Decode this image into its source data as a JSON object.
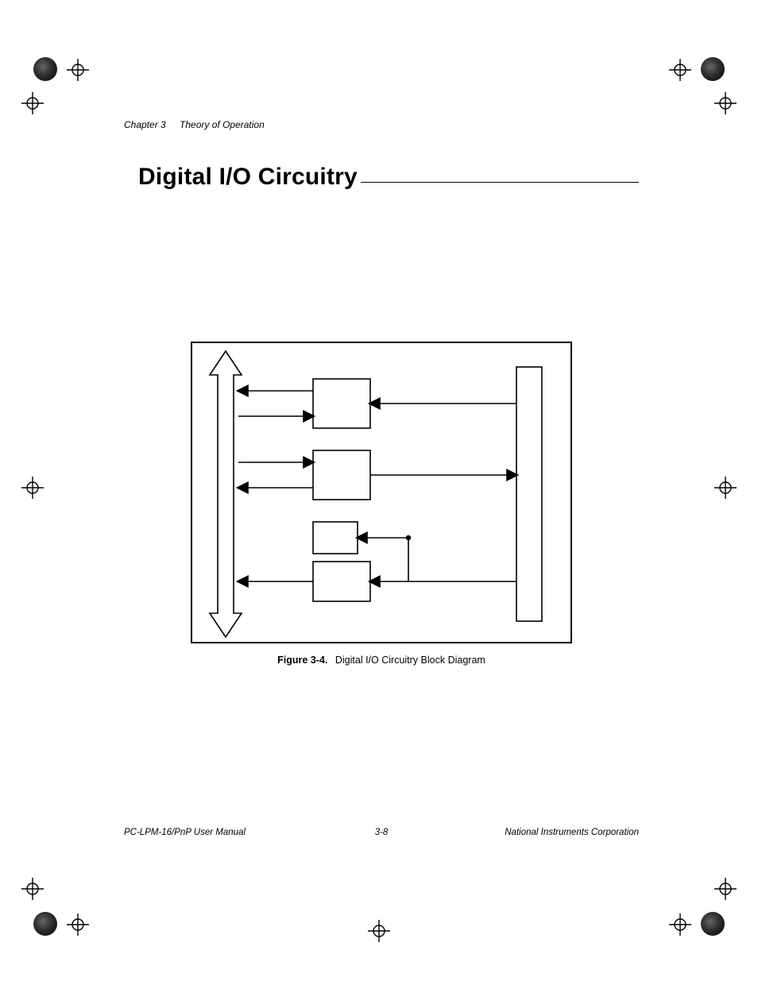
{
  "header": {
    "chapter_ref": "Chapter 3",
    "chapter_title": "Theory of Operation"
  },
  "section": {
    "title": "Digital I/O Circuitry"
  },
  "figure": {
    "number": "Figure 3-4.",
    "caption": "Digital I/O Circuitry Block Diagram"
  },
  "footer": {
    "left": "PC-LPM-16/PnP User Manual",
    "center": "3-8",
    "right": "National Instruments Corporation"
  }
}
